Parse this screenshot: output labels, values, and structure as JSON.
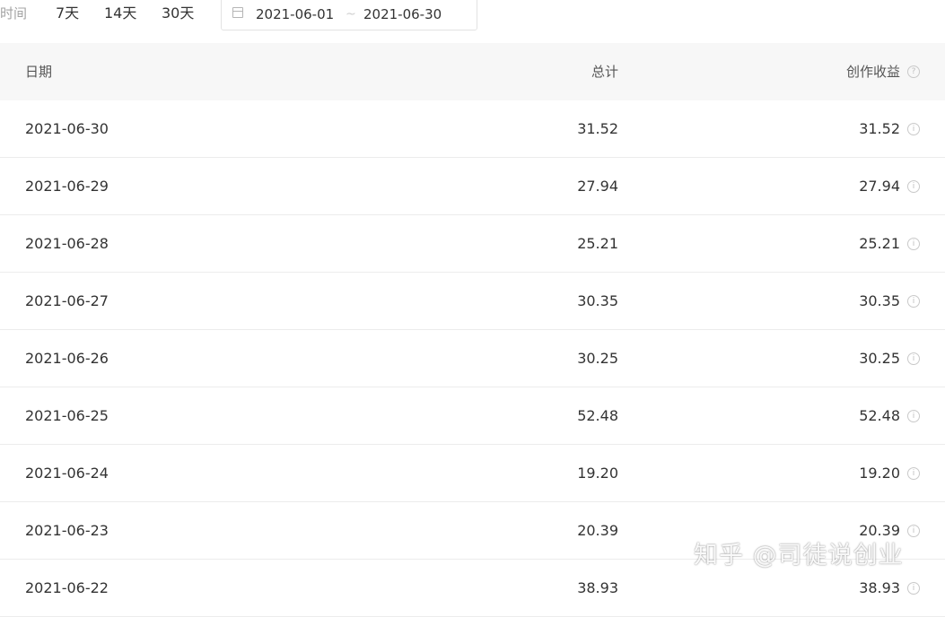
{
  "filter": {
    "label": "时间",
    "ranges": [
      "7天",
      "14天",
      "30天"
    ],
    "date_start": "2021-06-01",
    "date_separator": "~",
    "date_end": "2021-06-30"
  },
  "table": {
    "headers": {
      "date": "日期",
      "total": "总计",
      "income": "创作收益"
    },
    "rows": [
      {
        "date": "2021-06-30",
        "total": "31.52",
        "income": "31.52"
      },
      {
        "date": "2021-06-29",
        "total": "27.94",
        "income": "27.94"
      },
      {
        "date": "2021-06-28",
        "total": "25.21",
        "income": "25.21"
      },
      {
        "date": "2021-06-27",
        "total": "30.35",
        "income": "30.35"
      },
      {
        "date": "2021-06-26",
        "total": "30.25",
        "income": "30.25"
      },
      {
        "date": "2021-06-25",
        "total": "52.48",
        "income": "52.48"
      },
      {
        "date": "2021-06-24",
        "total": "19.20",
        "income": "19.20"
      },
      {
        "date": "2021-06-23",
        "total": "20.39",
        "income": "20.39"
      },
      {
        "date": "2021-06-22",
        "total": "38.93",
        "income": "38.93"
      }
    ]
  },
  "watermark": {
    "text": "知乎 @司徒说创业"
  },
  "icons": {
    "header_help": "question-circle-icon",
    "row_info": "info-circle-icon",
    "calendar": "calendar-icon"
  }
}
